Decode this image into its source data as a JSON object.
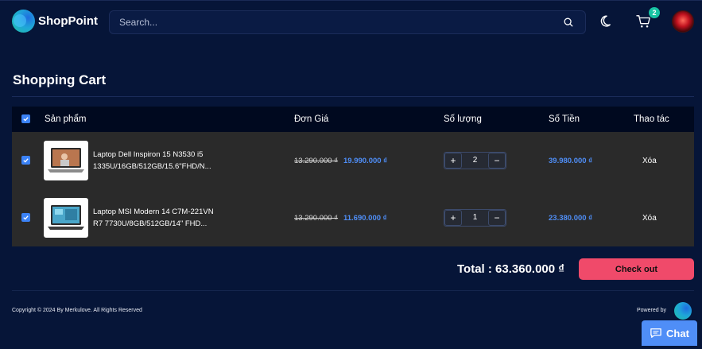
{
  "header": {
    "brand": "ShopPoint",
    "search_placeholder": "Search...",
    "cart_count": "2",
    "icons": [
      "logo-icon",
      "search-icon",
      "moon-icon",
      "cart-icon",
      "avatar"
    ]
  },
  "page": {
    "title": "Shopping Cart"
  },
  "table": {
    "headers": {
      "product": "Sản phẩm",
      "unit_price": "Đơn Giá",
      "quantity": "Số lượng",
      "amount": "Số Tiền",
      "action": "Thao tác"
    },
    "items": [
      {
        "name_line1": "Laptop Dell Inspiron 15 N3530 i5",
        "name_line2": "1335U/16GB/512GB/15.6\"FHD/N...",
        "old_price": "13.290.000 ₫",
        "new_price": "19.990.000 ₫",
        "quantity": "2",
        "subtotal": "39.980.000 ₫",
        "action": "Xóa",
        "checked": true
      },
      {
        "name_line1": "Laptop MSI Modern 14 C7M-221VN",
        "name_line2": "R7 7730U/8GB/512GB/14\" FHD...",
        "old_price": "13.290.000 ₫",
        "new_price": "11.690.000 ₫",
        "quantity": "1",
        "subtotal": "23.380.000 ₫",
        "action": "Xóa",
        "checked": true
      }
    ],
    "qty_plus": "+",
    "qty_minus": "−"
  },
  "summary": {
    "total": "Total : 63.360.000 ₫",
    "checkout_label": "Check out"
  },
  "footer": {
    "copyright": "Copyright © 2024 By Merkulove. All Rights Reserved",
    "powered_by": "Powered by"
  },
  "chat": {
    "label": "Chat"
  },
  "colors": {
    "background": "#061538",
    "table_header": "#00091f",
    "row": "#2a2a2a",
    "accent_blue": "#4f8ef7",
    "checkout": "#f04a6a",
    "badge": "#17c3a3"
  }
}
